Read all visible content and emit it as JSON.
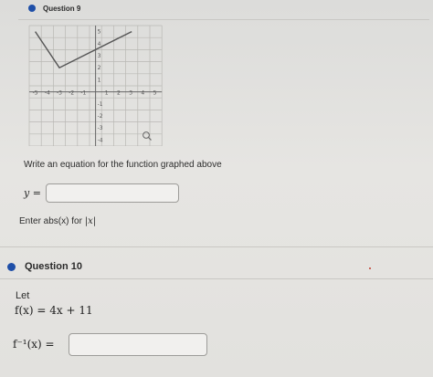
{
  "question9": {
    "title": "Question 9",
    "graph": {
      "x_ticks": [
        "-5",
        "-4",
        "-3",
        "-2",
        "-1",
        "1",
        "2",
        "3",
        "4",
        "5"
      ],
      "y_ticks": [
        "5",
        "4",
        "3",
        "2",
        "1",
        "-1",
        "-2",
        "-3",
        "-4",
        "-5"
      ],
      "curve": {
        "points": [
          [
            -5,
            5
          ],
          [
            -3,
            2
          ],
          [
            3,
            5
          ]
        ],
        "color": "#555555"
      },
      "magnifier_icon": "magnifier-icon"
    },
    "prompt": "Write an equation for the function graphed above",
    "answer_label": "y =",
    "answer_value": "",
    "hint_text": "Enter abs(x) for ",
    "hint_math": "|x|"
  },
  "question10": {
    "title": "Question 10",
    "let_label": "Let",
    "function_equation": "f(x) = 4x + 11",
    "answer_label": "f⁻¹(x) =",
    "answer_value": ""
  },
  "colors": {
    "accent": "#1f4fa8",
    "background": "#e2e1de",
    "input_bg": "#f1f0ee",
    "input_border": "#9d9c99"
  }
}
